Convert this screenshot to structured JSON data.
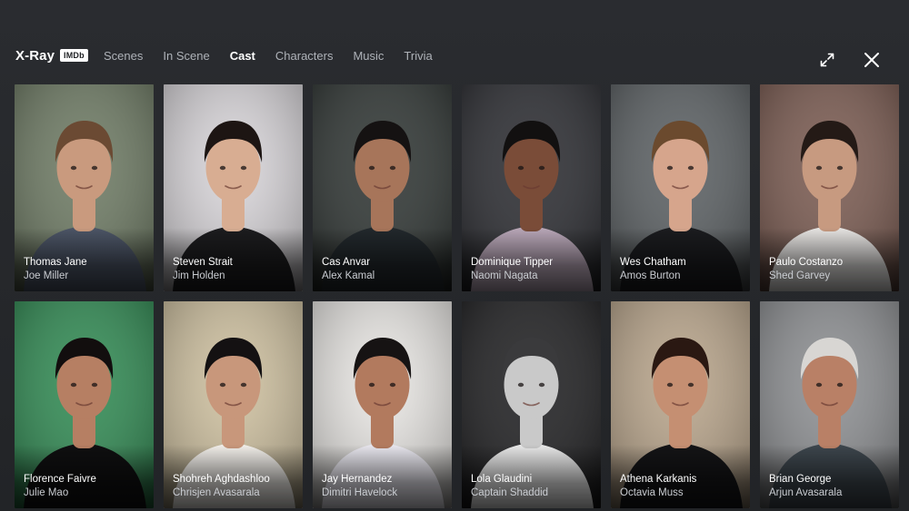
{
  "app": {
    "title": "X-Ray",
    "badge": "IMDb"
  },
  "tabs": [
    {
      "label": "Scenes",
      "active": false
    },
    {
      "label": "In Scene",
      "active": false
    },
    {
      "label": "Cast",
      "active": true
    },
    {
      "label": "Characters",
      "active": false
    },
    {
      "label": "Music",
      "active": false
    },
    {
      "label": "Trivia",
      "active": false
    }
  ],
  "controls": {
    "expand_icon": "expand-icon",
    "close_icon": "close-icon"
  },
  "cast": [
    {
      "actor": "Thomas Jane",
      "role": "Joe Miller",
      "bg": "#6d7a63",
      "skin": "#c99a7e",
      "hair": "#6b4a33",
      "shirt": "#4c5566"
    },
    {
      "actor": "Steven Strait",
      "role": "Jim Holden",
      "bg": "#d7d4d8",
      "skin": "#d8ad92",
      "hair": "#1d1513",
      "shirt": "#1c1c1e"
    },
    {
      "actor": "Cas Anvar",
      "role": "Alex Kamal",
      "bg": "#2e3432",
      "skin": "#a7755a",
      "hair": "#151212",
      "shirt": "#22282c"
    },
    {
      "actor": "Dominique Tipper",
      "role": "Naomi Nagata",
      "bg": "#2a2b30",
      "skin": "#7a4c38",
      "hair": "#121010",
      "shirt": "#b9a7b8"
    },
    {
      "actor": "Wes Chatham",
      "role": "Amos Burton",
      "bg": "#5a5f62",
      "skin": "#d6a58c",
      "hair": "#6b4a2e",
      "shirt": "#1b1c1f"
    },
    {
      "actor": "Paulo Costanzo",
      "role": "Shed Garvey",
      "bg": "#7a5a50",
      "skin": "#c79a80",
      "hair": "#241a16",
      "shirt": "#e6e4e2"
    },
    {
      "actor": "Florence Faivre",
      "role": "Julie Mao",
      "bg": "#2f8a52",
      "skin": "#b67f63",
      "hair": "#120e0e",
      "shirt": "#0f0f10"
    },
    {
      "actor": "Shohreh Aghdashloo",
      "role": "Chrisjen Avasarala",
      "bg": "#cdbf9e",
      "skin": "#c8977b",
      "hair": "#141112",
      "shirt": "#f2efea"
    },
    {
      "actor": "Jay Hernandez",
      "role": "Dimitri Havelock",
      "bg": "#e7e5e2",
      "skin": "#b27a5e",
      "hair": "#161313",
      "shirt": "#e8e6ee"
    },
    {
      "actor": "Lola Glaudini",
      "role": "Captain Shaddid",
      "bg": "#1e1e20",
      "skin": "#c9c9c9",
      "hair": "#3a3a3c",
      "shirt": "#e9e9e9"
    },
    {
      "actor": "Athena Karkanis",
      "role": "Octavia Muss",
      "bg": "#b8a48a",
      "skin": "#c58f72",
      "hair": "#2a1812",
      "shirt": "#141416"
    },
    {
      "actor": "Brian George",
      "role": "Arjun Avasarala",
      "bg": "#8c8e91",
      "skin": "#b98066",
      "hair": "#d8d6d3",
      "shirt": "#3d464d"
    }
  ]
}
